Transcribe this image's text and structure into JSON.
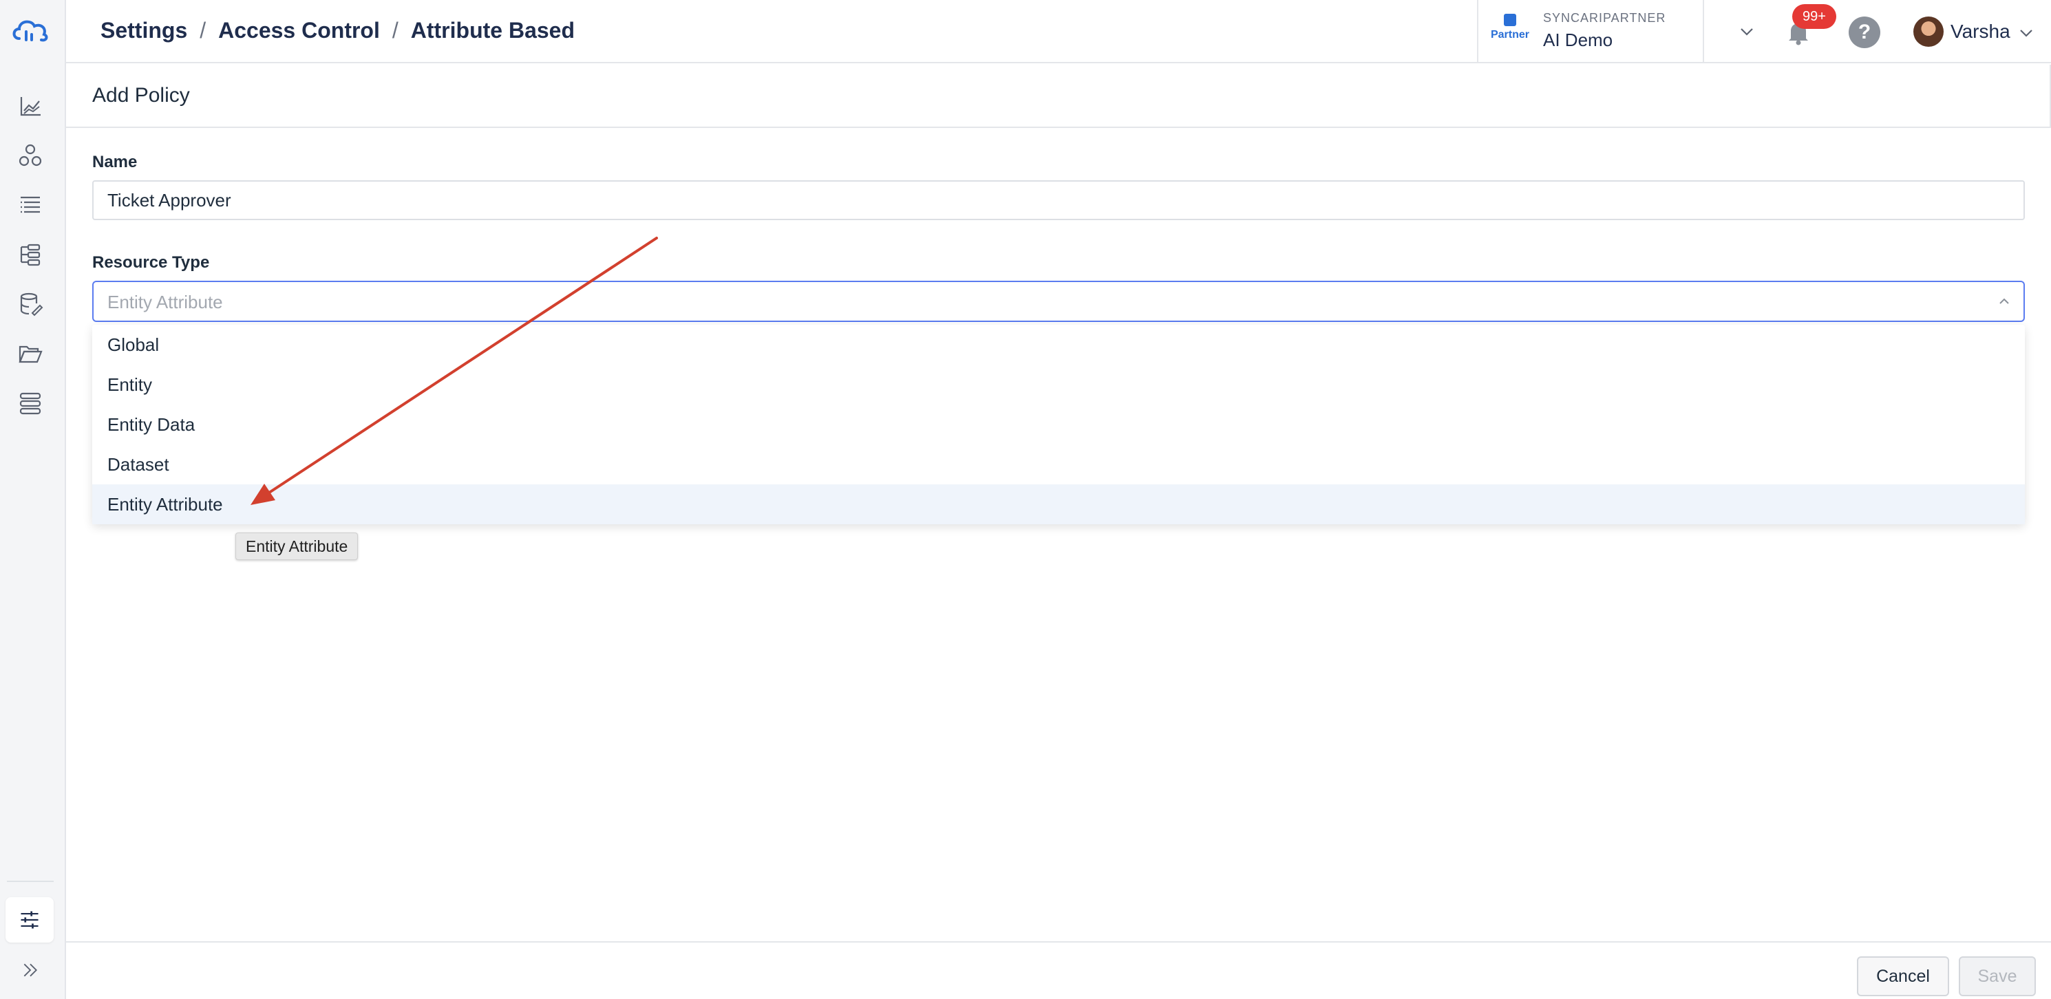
{
  "breadcrumb": {
    "items": [
      "Settings",
      "Access Control",
      "Attribute Based"
    ],
    "separator": "/"
  },
  "header": {
    "partner_label": "Partner",
    "org_label": "SYNCARIPARTNER",
    "org_name": "AI Demo",
    "notification_count": "99+",
    "help_label": "?",
    "user_name": "Varsha"
  },
  "panel": {
    "title": "Add Policy"
  },
  "form": {
    "name_label": "Name",
    "name_value": "Ticket Approver",
    "resource_label": "Resource Type",
    "resource_placeholder": "Entity Attribute",
    "options": [
      "Global",
      "Entity",
      "Entity Data",
      "Dataset",
      "Entity Attribute"
    ],
    "highlighted_option": "Entity Attribute",
    "tooltip": "Entity Attribute"
  },
  "footer": {
    "cancel_label": "Cancel",
    "save_label": "Save"
  },
  "colors": {
    "accent": "#5b7cf0",
    "brand": "#2a6fd6",
    "notification": "#e53935",
    "annotation_arrow": "#d2402e"
  },
  "icons": {
    "sidebar": [
      "dashboard-chart-icon",
      "entities-icon",
      "list-icon",
      "pipeline-icon",
      "database-icon",
      "folder-icon",
      "stack-icon",
      "settings-sliders-icon",
      "expand-icon"
    ]
  }
}
